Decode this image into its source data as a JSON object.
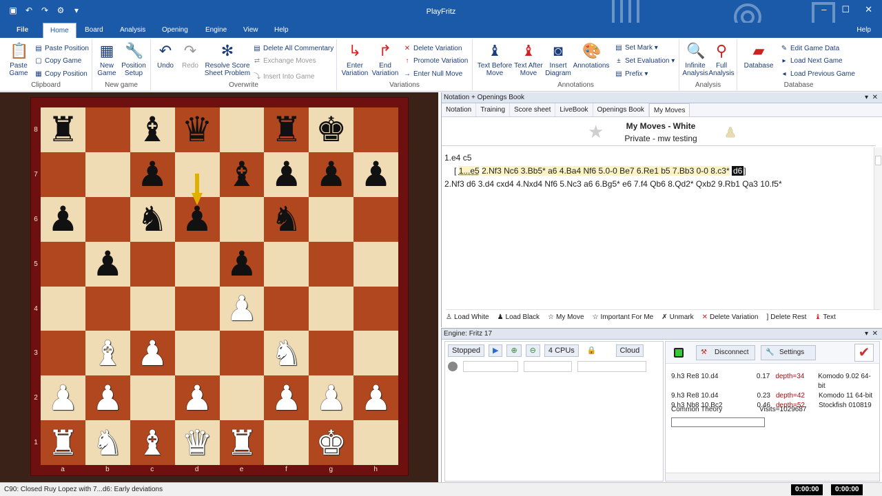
{
  "app": {
    "title": "PlayFritz"
  },
  "menu_tabs": [
    {
      "label": "File"
    },
    {
      "label": "Home"
    },
    {
      "label": "Board"
    },
    {
      "label": "Analysis"
    },
    {
      "label": "Opening"
    },
    {
      "label": "Engine"
    },
    {
      "label": "View"
    },
    {
      "label": "Help"
    }
  ],
  "help_right": "Help",
  "ribbon": {
    "clipboard": {
      "label": "Clipboard",
      "paste_game": "Paste\nGame",
      "paste_position": "Paste Position",
      "copy_game": "Copy Game",
      "copy_position": "Copy Position"
    },
    "new_game": {
      "label": "New game",
      "new": "New\nGame",
      "setup": "Position\nSetup"
    },
    "overwrite": {
      "label": "Overwrite",
      "undo": "Undo",
      "redo": "Redo",
      "resolve": "Resolve Score\nSheet Problem",
      "delete_all": "Delete All Commentary",
      "exchange": "Exchange Moves",
      "insert_into": "Insert Into Game"
    },
    "variations": {
      "label": "Variations",
      "enter": "Enter\nVariation",
      "end": "End\nVariation",
      "delete": "Delete Variation",
      "promote": "Promote Variation",
      "null": "Enter Null Move"
    },
    "annotations": {
      "label": "Annotations",
      "text_before": "Text Before\nMove",
      "text_after": "Text After\nMove",
      "insert_diagram": "Insert\nDiagram",
      "annotations": "Annotations",
      "set_mark": "Set Mark",
      "set_eval": "Set Evaluation",
      "prefix": "Prefix"
    },
    "analysis": {
      "label": "Analysis",
      "infinite": "Infinite\nAnalysis",
      "full": "Full\nAnalysis"
    },
    "database": {
      "label": "Database",
      "database": "Database",
      "edit": "Edit Game Data",
      "next": "Load Next Game",
      "prev": "Load Previous Game"
    }
  },
  "board": {
    "ranks": [
      "8",
      "7",
      "6",
      "5",
      "4",
      "3",
      "2",
      "1"
    ],
    "files": [
      "a",
      "b",
      "c",
      "d",
      "e",
      "f",
      "g",
      "h"
    ],
    "position": [
      [
        "br",
        "",
        "bb",
        "bq",
        "",
        "br",
        "bk",
        ""
      ],
      [
        "",
        "",
        "bp",
        "",
        "bb",
        "bp",
        "bp",
        "bp"
      ],
      [
        "bp",
        "",
        "bn",
        "bp",
        "",
        "bn",
        "",
        ""
      ],
      [
        "",
        "bp",
        "",
        "",
        "bp",
        "",
        "",
        ""
      ],
      [
        "",
        "",
        "",
        "",
        "wp",
        "",
        "",
        ""
      ],
      [
        "",
        "wb",
        "wp",
        "",
        "",
        "wn",
        "",
        ""
      ],
      [
        "wp",
        "wp",
        "",
        "wp",
        "",
        "wp",
        "wp",
        "wp"
      ],
      [
        "wr",
        "wn",
        "wb",
        "wq",
        "wr",
        "",
        "wk",
        ""
      ]
    ],
    "last_move_arrow": "d7-d6",
    "arrow_color": "#e0b000"
  },
  "notation": {
    "panel_title": "Notation + Openings Book",
    "tabs": [
      "Notation",
      "Training",
      "Score sheet",
      "LiveBook",
      "Openings Book",
      "My Moves"
    ],
    "header_title": "My Moves - White",
    "header_sub": "Private - mw testing",
    "line1": "1.e4  c5",
    "var_open": "[",
    "var_first": "1...e5",
    "var_moves": "2.Nf3  Nc6  3.Bb5*  a6  4.Ba4  Nf6  5.0-0  Be7  6.Re1  b5  7.Bb3  0-0  8.c3*",
    "var_current": "d6",
    "var_close": "]",
    "line3": "2.Nf3  d6  3.d4  cxd4  4.Nxd4  Nf6  5.Nc3  a6  6.Bg5*  e6  7.f4  Qb6  8.Qd2*  Qxb2  9.Rb1  Qa3  10.f5*",
    "toolbar": [
      "Load White",
      "Load Black",
      "My Move",
      "Important For Me",
      "Unmark",
      "Delete Variation",
      "Delete Rest",
      "Text"
    ]
  },
  "engine": {
    "panel_title": "Engine: Fritz 17",
    "status": "Stopped",
    "cpus": "4 CPUs",
    "cloud": "Cloud",
    "disconnect": "Disconnect",
    "settings": "Settings",
    "cloud_rows": [
      {
        "line": "9.h3 Re8 10.d4",
        "score": "0.17",
        "depth": "depth=34",
        "engine": "Komodo 9.02 64-bit"
      },
      {
        "line": "9.h3 Re8 10.d4",
        "score": "0.23",
        "depth": "depth=42",
        "engine": "Komodo 11 64-bit"
      },
      {
        "line": "9.h3 Nb8 10.Bc2",
        "score": "0.46",
        "depth": "depth=52",
        "engine": "Stockfish 010819"
      }
    ],
    "common_theory": "Common Theory",
    "visits": "Visits=1029687"
  },
  "status_bar": {
    "text": "C90: Closed Ruy Lopez with 7...d6: Early deviations",
    "clock_white": "0:00:00",
    "clock_black": "0:00:00"
  }
}
